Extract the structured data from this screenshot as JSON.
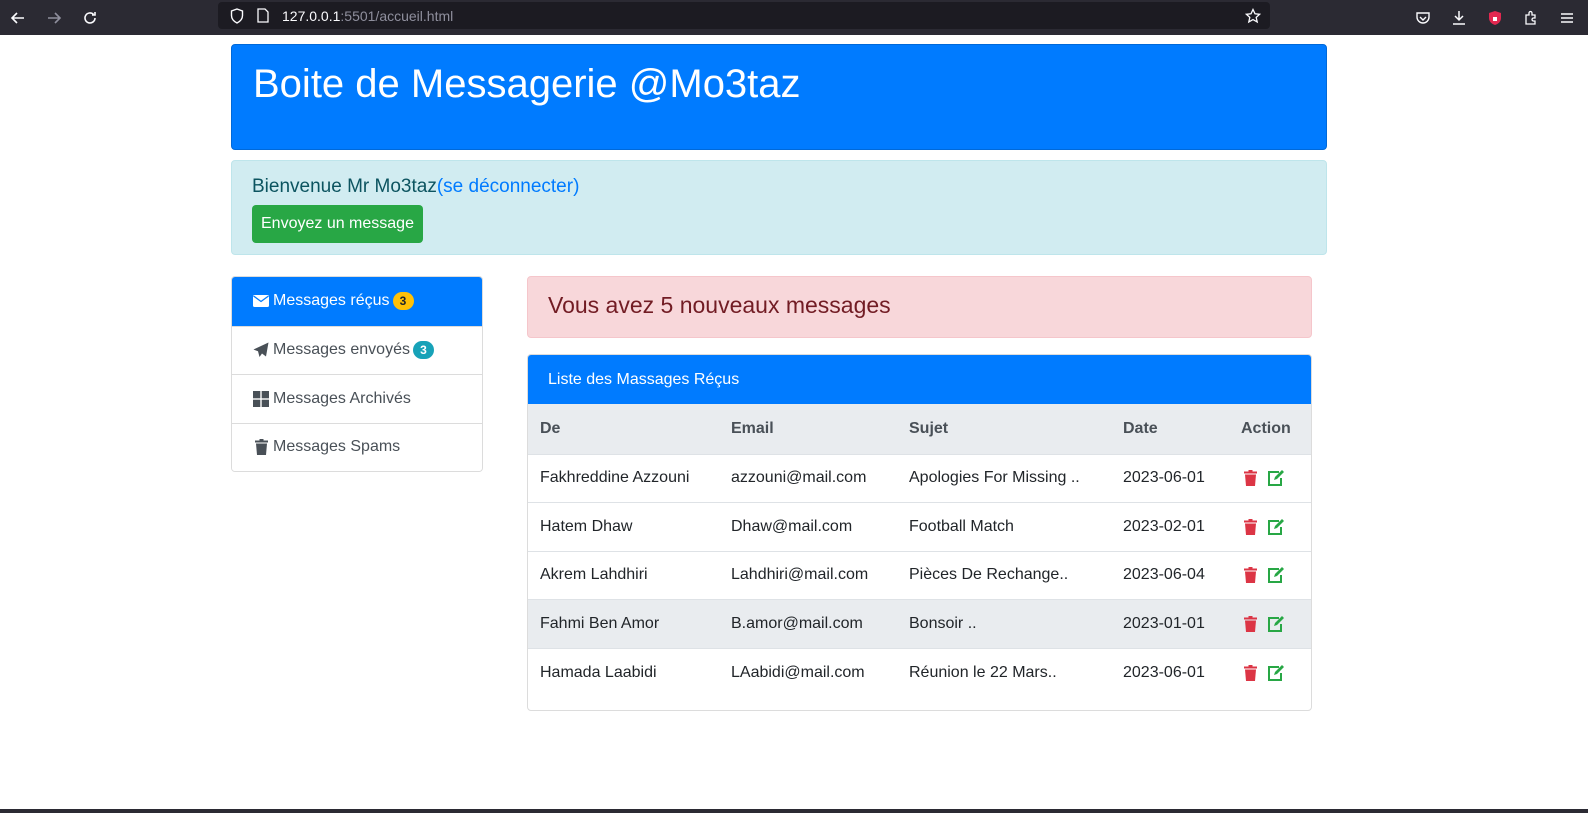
{
  "browser": {
    "url_host": "127.0.0.1",
    "url_rest": ":5501/accueil.html"
  },
  "header": {
    "title": "Boite de Messagerie @Mo3taz"
  },
  "welcome": {
    "greeting": "Bienvenue Mr Mo3taz",
    "logout_link": "(se déconnecter)",
    "send_button": "Envoyez un message"
  },
  "sidebar": {
    "items": [
      {
        "label": "Messages réçus",
        "badge": "3",
        "icon": "envelope-icon"
      },
      {
        "label": "Messages envoyés",
        "badge": "3",
        "icon": "paper-plane-icon"
      },
      {
        "label": "Messages Archivés",
        "icon": "grid-icon"
      },
      {
        "label": "Messages Spams",
        "icon": "trash-icon"
      }
    ]
  },
  "alert": {
    "text": "Vous avez 5 nouveaux messages"
  },
  "inbox": {
    "title": "Liste des Massages Réçus",
    "columns": [
      "De",
      "Email",
      "Sujet",
      "Date",
      "Action"
    ],
    "rows": [
      {
        "from": "Fakhreddine Azzouni",
        "email": "azzouni@mail.com",
        "subject": "Apologies For Missing ..",
        "date": "2023-06-01"
      },
      {
        "from": "Hatem Dhaw",
        "email": "Dhaw@mail.com",
        "subject": "Football Match",
        "date": "2023-02-01"
      },
      {
        "from": "Akrem Lahdhiri",
        "email": "Lahdhiri@mail.com",
        "subject": "Pièces De Rechange..",
        "date": "2023-06-04"
      },
      {
        "from": "Fahmi Ben Amor",
        "email": "B.amor@mail.com",
        "subject": "Bonsoir ..",
        "date": "2023-01-01"
      },
      {
        "from": "Hamada Laabidi",
        "email": "LAabidi@mail.com",
        "subject": "Réunion le 22 Mars..",
        "date": "2023-06-01"
      }
    ]
  },
  "colors": {
    "primary": "#007bff",
    "success": "#28a745",
    "danger": "#dc3545",
    "warning": "#ffc107",
    "info": "#17a2b8"
  }
}
